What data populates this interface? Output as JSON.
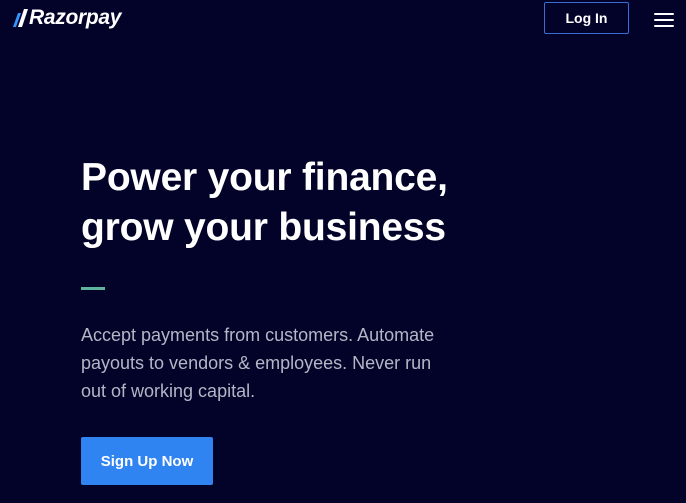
{
  "header": {
    "logo_text": "Razorpay",
    "logo_icon": "razorpay-logo-mark",
    "login_label": "Log In",
    "menu_icon": "hamburger-menu-icon"
  },
  "hero": {
    "title_line1": "Power your finance,",
    "title_line2": "grow your business",
    "subtitle_line1": "Accept payments from customers. Automate",
    "subtitle_line2": "payouts to vendors & employees. Never run",
    "subtitle_line3": "out of working capital.",
    "cta_label": "Sign Up Now"
  },
  "colors": {
    "background": "#03032a",
    "brand_blue": "#3084f1",
    "login_border": "#3a6cd6",
    "accent_green": "#5fb39a",
    "subtitle_text": "#b4b6c6"
  }
}
